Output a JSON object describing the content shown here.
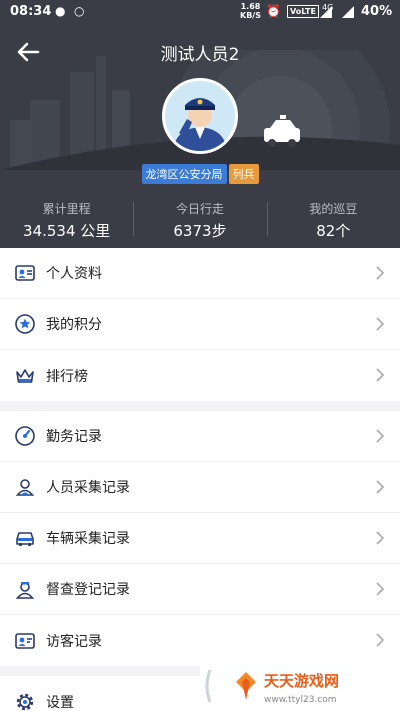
{
  "status_bar": {
    "time": "08:34",
    "speed_top": "1.68",
    "speed_unit": "KB/S",
    "volte": "VoLTE",
    "network": "4G",
    "battery": "40%"
  },
  "header": {
    "title": "测试人员2"
  },
  "profile": {
    "unit": "龙湾区公安分局",
    "rank": "列兵"
  },
  "stats": [
    {
      "label": "累计里程",
      "value": "34.534 公里"
    },
    {
      "label": "今日行走",
      "value": "6373步"
    },
    {
      "label": "我的巡豆",
      "value": "82个"
    }
  ],
  "menu_group1": [
    {
      "label": "个人资料",
      "icon": "id-card-icon"
    },
    {
      "label": "我的积分",
      "icon": "star-icon"
    },
    {
      "label": "排行榜",
      "icon": "crown-icon"
    }
  ],
  "menu_group2": [
    {
      "label": "勤务记录",
      "icon": "gauge-icon"
    },
    {
      "label": "人员采集记录",
      "icon": "person-icon"
    },
    {
      "label": "车辆采集记录",
      "icon": "car-icon"
    },
    {
      "label": "督查登记记录",
      "icon": "inspector-icon"
    },
    {
      "label": "访客记录",
      "icon": "visitor-icon"
    }
  ],
  "menu_group3": [
    {
      "label": "设置",
      "icon": "gear-icon"
    }
  ],
  "watermark": {
    "brand": "天天游戏网",
    "url": "www.ttyl23.com"
  },
  "colors": {
    "header_bg": "#3a3d45",
    "unit_badge": "#3c7bd6",
    "rank_badge": "#e8993a",
    "icon_blue": "#2a6fd6"
  }
}
